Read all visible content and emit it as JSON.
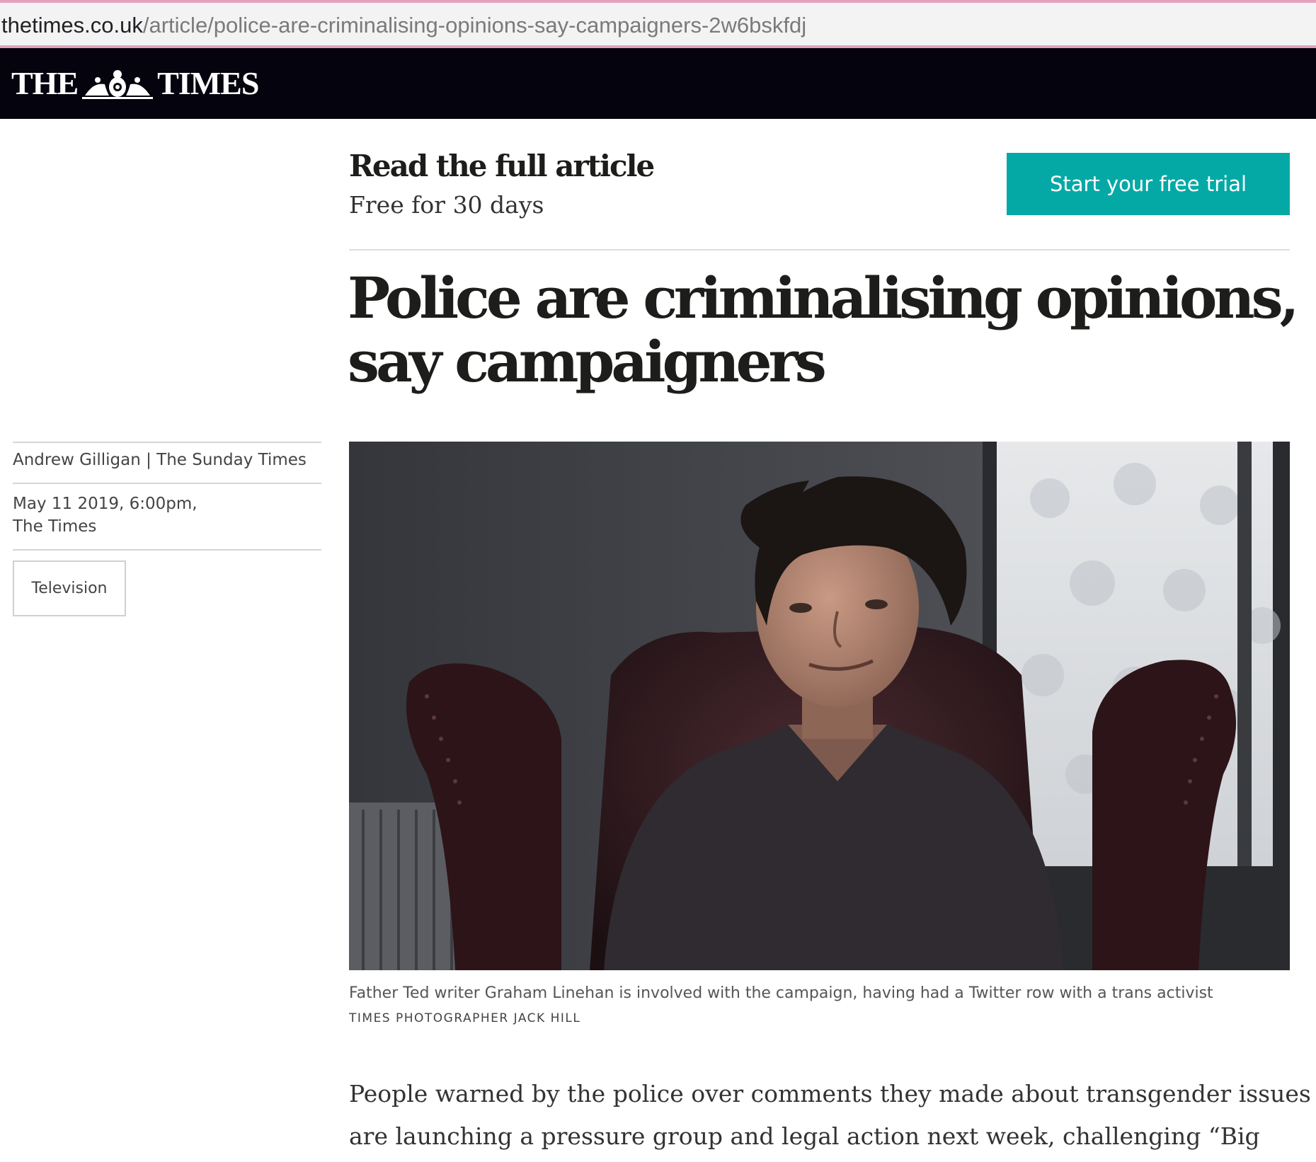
{
  "browser": {
    "url_host": "thetimes.co.uk",
    "url_path": "/article/police-are-criminalising-opinions-say-campaigners-2w6bskfdj"
  },
  "masthead": {
    "logo_left": "THE",
    "logo_right": "TIMES",
    "background": "#05040e"
  },
  "promo": {
    "title": "Read the full article",
    "subtitle": "Free for 30 days",
    "cta_label": "Start your free trial",
    "cta_color": "#04a9a6"
  },
  "article": {
    "headline": "Police are criminalising opinions, say campaigners",
    "byline": "Andrew Gilligan | The Sunday Times",
    "date": "May 11 2019, 6:00pm,",
    "publication": "The Times",
    "tag": "Television",
    "image_caption": "Father Ted writer Graham Linehan is involved with the campaign, having had a Twitter row with a trans activist",
    "image_credit": "TIMES PHOTOGRAPHER JACK HILL",
    "body_lines": [
      "People warned by the police over comments they made about transgender issues",
      "are launching a pressure group and legal action next week, challenging “Big"
    ]
  },
  "icons": {
    "crest": "royal-crest-icon"
  }
}
